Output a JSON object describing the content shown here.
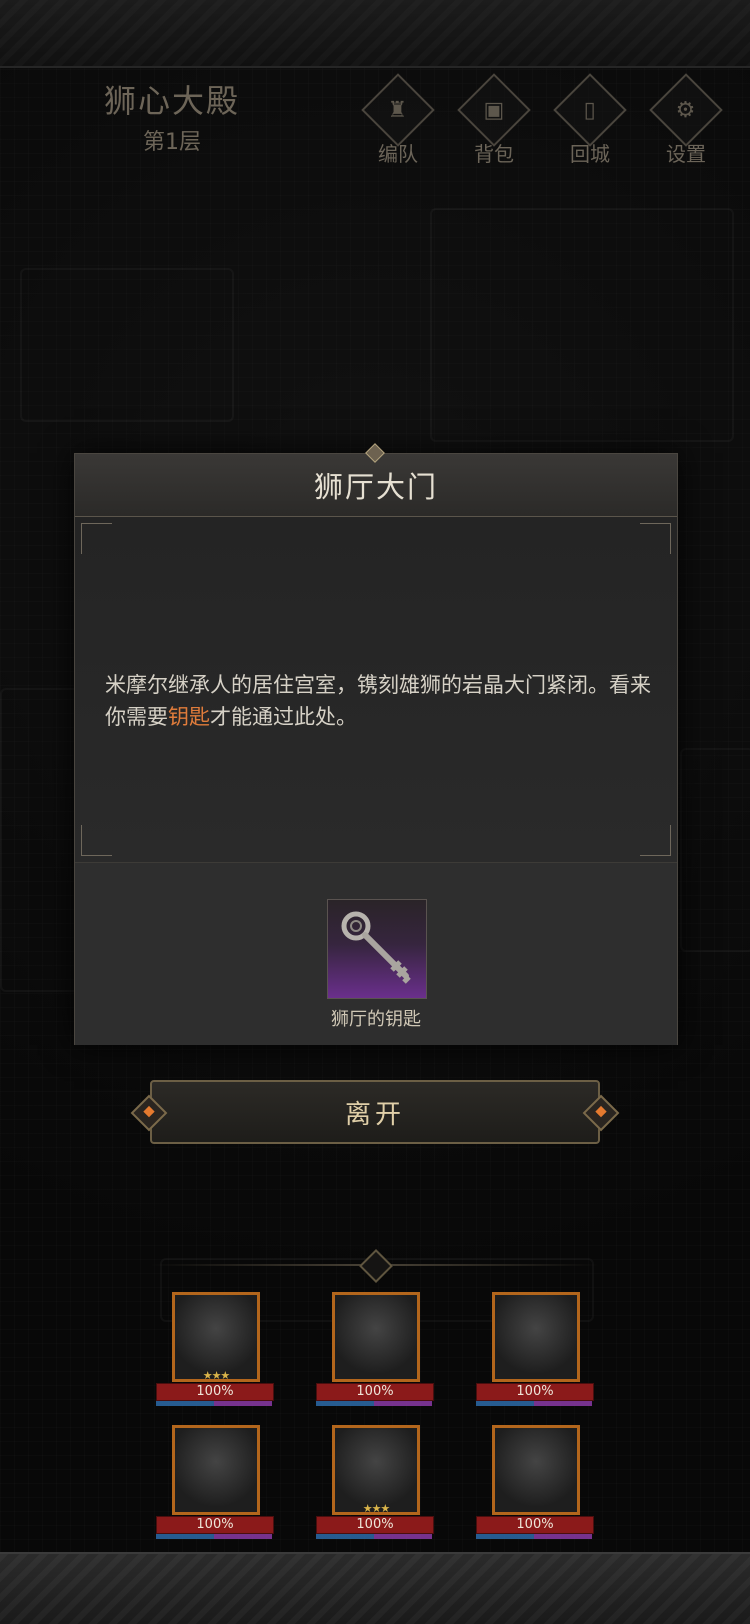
{
  "location": {
    "name": "狮心大殿",
    "floor": "第1层"
  },
  "menu": [
    {
      "label": "编队",
      "icon": "horned-helmet-icon"
    },
    {
      "label": "背包",
      "icon": "backpack-icon"
    },
    {
      "label": "回城",
      "icon": "door-icon"
    },
    {
      "label": "设置",
      "icon": "gear-icon"
    }
  ],
  "dialog": {
    "title": "狮厅大门",
    "description_before": "米摩尔继承人的居住宫室，镌刻雄狮的岩晶大门紧闭。看来你需要",
    "description_highlight": "钥匙",
    "description_after": "才能通过此处。",
    "highlight_color": "#e07c3b",
    "required_item": {
      "name": "狮厅的钥匙",
      "icon": "key-icon",
      "rarity_color": "#6a2f8c"
    }
  },
  "leave_button": {
    "label": "离开"
  },
  "party": [
    {
      "hp": "100%",
      "stars": "★★★",
      "portrait": "beast-warrior-icon"
    },
    {
      "hp": "100%",
      "stars": "",
      "portrait": "antlered-druid-icon"
    },
    {
      "hp": "100%",
      "stars": "",
      "portrait": "blonde-mage-icon"
    },
    {
      "hp": "100%",
      "stars": "",
      "portrait": "dark-knight-icon"
    },
    {
      "hp": "100%",
      "stars": "★★★",
      "portrait": "silver-hair-elf-icon"
    },
    {
      "hp": "100%",
      "stars": "",
      "portrait": "crowned-priestess-icon"
    }
  ]
}
